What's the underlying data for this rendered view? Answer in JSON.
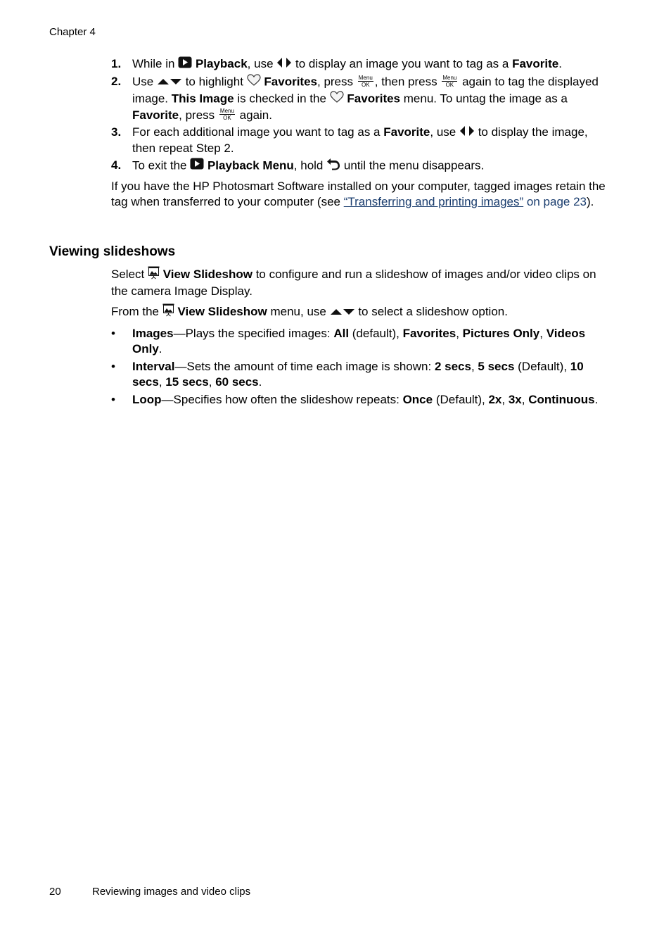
{
  "page_header": {
    "chapter": "Chapter 4"
  },
  "steps": [
    {
      "num": "1.",
      "t1": "While in",
      "b1": "Playback",
      "t2": ", use",
      "t3": "to display an image you want to tag as a",
      "b2": "Favorite",
      "t4": "."
    },
    {
      "num": "2.",
      "t1": "Use",
      "t2": "to highlight",
      "b1": "Favorites",
      "t3": ", press",
      "t4": ", then press",
      "t5": "again to tag the displayed image.",
      "b2": "This Image",
      "t6": "is checked in the",
      "b3": "Favorites",
      "t7": "menu. To untag the image as a",
      "b4": "Favorite",
      "t8": ", press",
      "t9": "again."
    },
    {
      "num": "3.",
      "t1": "For each additional image you want to tag as a",
      "b1": "Favorite",
      "t2": ", use",
      "t3": "to display the image, then repeat Step 2."
    },
    {
      "num": "4.",
      "t1": "To exit the",
      "b1": "Playback Menu",
      "t2": ", hold",
      "t3": "until the menu disappears."
    }
  ],
  "menu_ok": {
    "top": "Menu",
    "bottom": "OK"
  },
  "transfer_note": {
    "t1": "If you have the HP Photosmart Software installed on your computer, tagged images retain the tag when transferred to your computer (see ",
    "link_text": "“Transferring and printing images”",
    "link_page": "on page 23",
    "t2": ")."
  },
  "section": {
    "title": "Viewing slideshows",
    "intro": {
      "t1": "Select",
      "b1": "View Slideshow",
      "t2": "to configure and run a slideshow of images and/or video clips on the camera Image Display."
    },
    "from": {
      "t1": "From the",
      "b1": "View Slideshow",
      "t2": "menu, use",
      "t3": "to select a slideshow option."
    },
    "options": [
      {
        "name": "Images",
        "desc": "—Plays the specified images: ",
        "v1": "All",
        "s1": " (default), ",
        "v2": "Favorites",
        "s2": ", ",
        "v3": "Pictures Only",
        "s3": ", ",
        "v4": "Videos Only",
        "s4": "."
      },
      {
        "name": "Interval",
        "desc": "—Sets the amount of time each image is shown: ",
        "v1": "2 secs",
        "s1": ", ",
        "v2": "5 secs",
        "s2": " (Default), ",
        "v3": "10 secs",
        "s3": ", ",
        "v4": "15 secs",
        "s4": ", ",
        "v5": "60 secs",
        "s5": "."
      },
      {
        "name": "Loop",
        "desc": "—Specifies how often the slideshow repeats: ",
        "v1": "Once",
        "s1": " (Default), ",
        "v2": "2x",
        "s2": ", ",
        "v3": "3x",
        "s3": ", ",
        "v4": "Continuous",
        "s4": "."
      }
    ]
  },
  "page_footer": {
    "page_number": "20",
    "title": "Reviewing images and video clips"
  },
  "colors": {
    "link": "#1a3d6e",
    "text": "#000000"
  }
}
